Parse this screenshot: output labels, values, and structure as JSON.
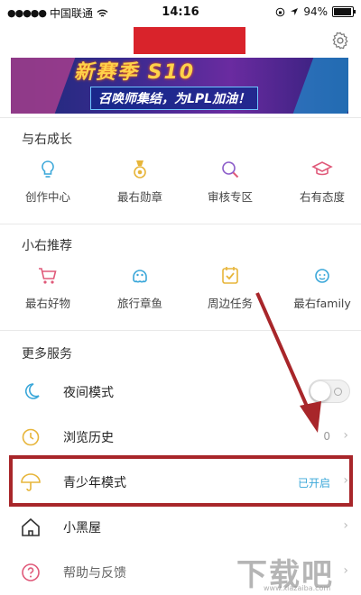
{
  "status_bar": {
    "signal": "●●●●●",
    "carrier": "中国联通",
    "time": "14:16",
    "battery": "94%"
  },
  "banner": {
    "top_text": "新赛季 S10",
    "bottom_text": "召唤师集结，为LPL加油！"
  },
  "sections": {
    "grow": {
      "title": "与右成长",
      "items": [
        {
          "label": "创作中心",
          "icon": "lightbulb-icon"
        },
        {
          "label": "最右勋章",
          "icon": "medal-icon"
        },
        {
          "label": "审核专区",
          "icon": "magnifier-icon"
        },
        {
          "label": "右有态度",
          "icon": "graduation-cap-icon"
        }
      ]
    },
    "recommend": {
      "title": "小右推荐",
      "items": [
        {
          "label": "最右好物",
          "icon": "cart-icon"
        },
        {
          "label": "旅行章鱼",
          "icon": "octopus-icon"
        },
        {
          "label": "周边任务",
          "icon": "task-check-icon"
        },
        {
          "label": "最右family",
          "icon": "family-icon"
        }
      ]
    },
    "more": {
      "title": "更多服务",
      "rows": [
        {
          "label": "夜间模式",
          "icon": "moon-icon",
          "toggle_on": false
        },
        {
          "label": "浏览历史",
          "icon": "clock-icon",
          "meta": "0"
        },
        {
          "label": "青少年模式",
          "icon": "umbrella-icon",
          "meta": "已开启"
        },
        {
          "label": "小黑屋",
          "icon": "house-icon"
        },
        {
          "label": "帮助与反馈",
          "icon": "help-icon"
        }
      ]
    }
  },
  "watermark": {
    "text": "下载吧",
    "url": "www.xiazaiba.com"
  },
  "colors": {
    "accent_blue": "#3aa7d9",
    "highlight_red": "#a8262a",
    "icon_yellow": "#e7b53a",
    "icon_purple": "#8b5cc9",
    "icon_pink": "#e05a7a"
  }
}
